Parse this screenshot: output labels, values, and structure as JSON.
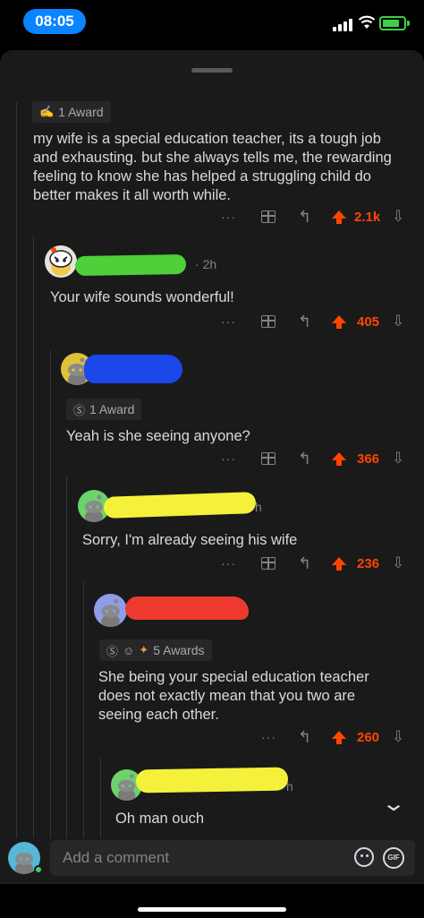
{
  "status_bar": {
    "time": "08:05",
    "accent": "#0a84ff",
    "battery_color": "#3ecf4a"
  },
  "comments": [
    {
      "award": "1 Award",
      "body": "my wife is a special education teacher, its a tough job and exhausting. but she always tells me, the rewarding feeling to know she has helped a struggling child do better makes it all worth while.",
      "score": "2.1k"
    },
    {
      "timestamp": "2h",
      "body": "Your wife sounds wonderful!",
      "score": "405"
    },
    {
      "award": "1 Award",
      "body": "Yeah is she seeing anyone?",
      "score": "366"
    },
    {
      "timestamp": "h",
      "body": "Sorry, I'm already seeing his wife",
      "score": "236"
    },
    {
      "award": "5 Awards",
      "body": "She being your special education teacher does not exactly mean that you two are seeing each other.",
      "score": "260"
    },
    {
      "timestamp": "h",
      "body": "Oh man ouch"
    }
  ],
  "actions": {
    "more": "···",
    "reply_icon": "reply-icon",
    "gift_icon": "gift-icon",
    "upvote_color": "#ff4500"
  },
  "composer": {
    "placeholder": "Add a comment",
    "gif_label": "GIF"
  }
}
